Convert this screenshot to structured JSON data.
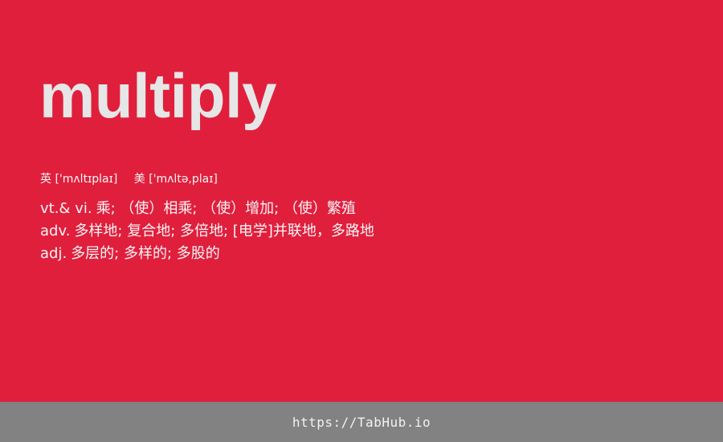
{
  "entry": {
    "word": "multiply",
    "phonetics": {
      "uk_label": "英",
      "uk": "['mʌltɪplaɪ]",
      "us_label": "美",
      "us": "['mʌltə,plaɪ]"
    },
    "definitions": [
      {
        "pos": "vt.& vi.",
        "meaning": "乘; （使）相乘; （使）增加; （使）繁殖"
      },
      {
        "pos": "adv.",
        "meaning": "多样地; 复合地; 多倍地; [电学]并联地，多路地"
      },
      {
        "pos": "adj.",
        "meaning": "多层的; 多样的; 多股的"
      }
    ]
  },
  "footer": {
    "url": "https://TabHub.io"
  },
  "colors": {
    "background": "#e01f3d",
    "word": "#e6e6e6",
    "footer_bar": "#828282"
  }
}
